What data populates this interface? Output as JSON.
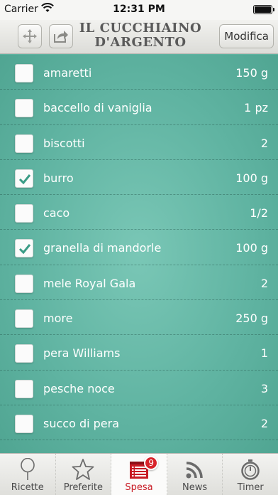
{
  "status_bar": {
    "carrier": "Carrier",
    "time": "12:31 PM"
  },
  "nav": {
    "logo_line1": "IL CUCCHIAINO",
    "logo_line2": "D'ARGENTO",
    "edit_label": "Modifica"
  },
  "items": [
    {
      "name": "amaretti",
      "qty": "150 g",
      "checked": false
    },
    {
      "name": "baccello di vaniglia",
      "qty": "1 pz",
      "checked": false
    },
    {
      "name": "biscotti",
      "qty": "2",
      "checked": false
    },
    {
      "name": "burro",
      "qty": "100 g",
      "checked": true
    },
    {
      "name": "caco",
      "qty": "1/2",
      "checked": false
    },
    {
      "name": "granella di mandorle",
      "qty": "100 g",
      "checked": true
    },
    {
      "name": "mele Royal Gala",
      "qty": "2",
      "checked": false
    },
    {
      "name": "more",
      "qty": "250 g",
      "checked": false
    },
    {
      "name": "pera Williams",
      "qty": "1",
      "checked": false
    },
    {
      "name": "pesche noce",
      "qty": "3",
      "checked": false
    },
    {
      "name": "succo di pera",
      "qty": "2",
      "checked": false
    }
  ],
  "tabs": [
    {
      "label": "Ricette",
      "icon": "spoon-icon",
      "active": false
    },
    {
      "label": "Preferite",
      "icon": "star-icon",
      "active": false
    },
    {
      "label": "Spesa",
      "icon": "shopping-list-icon",
      "active": true,
      "badge": "9"
    },
    {
      "label": "News",
      "icon": "rss-icon",
      "active": false
    },
    {
      "label": "Timer",
      "icon": "stopwatch-icon",
      "active": false
    }
  ],
  "colors": {
    "list_background": "#5fb3a1",
    "check_mark": "#3a9c86",
    "active_tab": "#c81b24",
    "badge": "#d8232a"
  }
}
